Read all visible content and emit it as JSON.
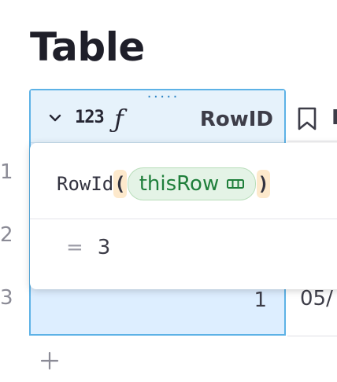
{
  "page": {
    "title": "Table"
  },
  "row_numbers": [
    "1",
    "2",
    "3"
  ],
  "column": {
    "type_label": "123",
    "formula_icon": "ƒ",
    "name": "RowID",
    "drag_handle": "·····",
    "cell_value": "1"
  },
  "next_column": {
    "icon": "bookmark-icon",
    "name": "I",
    "cell_value": "05/"
  },
  "editor": {
    "function_name": "RowId",
    "open_paren": "(",
    "close_paren": ")",
    "argument": "thisRow",
    "result_prefix": "=",
    "result_value": "3"
  },
  "colors": {
    "selection_border": "#5db2e6",
    "selection_bg": "#ddeeff",
    "pill_bg": "#e4f3e6",
    "pill_text": "#1f7f3b",
    "paren_bg": "#fde9cc"
  },
  "icons": {
    "chevron": "chevron-down-icon",
    "add_row": "plus-icon"
  }
}
